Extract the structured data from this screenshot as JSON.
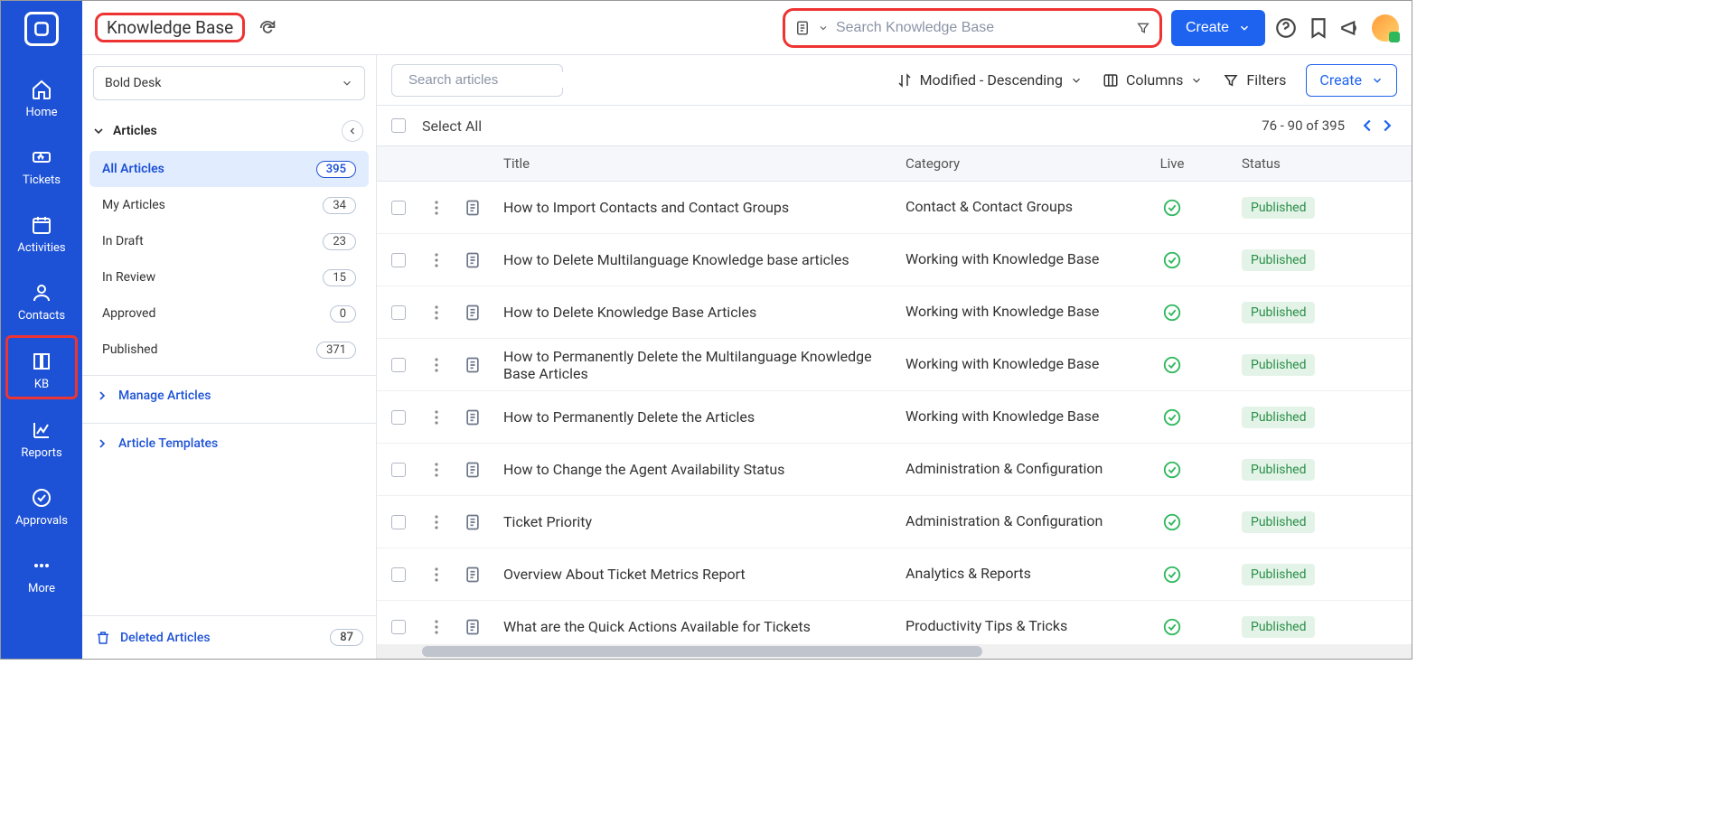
{
  "page": {
    "title": "Knowledge Base"
  },
  "global_search": {
    "placeholder": "Search Knowledge Base"
  },
  "top_create": "Create",
  "sidenav": [
    {
      "id": "home",
      "label": "Home"
    },
    {
      "id": "tickets",
      "label": "Tickets"
    },
    {
      "id": "activities",
      "label": "Activities"
    },
    {
      "id": "contacts",
      "label": "Contacts"
    },
    {
      "id": "kb",
      "label": "KB"
    },
    {
      "id": "reports",
      "label": "Reports"
    },
    {
      "id": "approvals",
      "label": "Approvals"
    },
    {
      "id": "more",
      "label": "More"
    }
  ],
  "brand_selected": "Bold Desk",
  "articles_section": "Articles",
  "views": [
    {
      "label": "All Articles",
      "count": "395"
    },
    {
      "label": "My Articles",
      "count": "34"
    },
    {
      "label": "In Draft",
      "count": "23"
    },
    {
      "label": "In Review",
      "count": "15"
    },
    {
      "label": "Approved",
      "count": "0"
    },
    {
      "label": "Published",
      "count": "371"
    }
  ],
  "manage_articles": "Manage Articles",
  "article_templates": "Article Templates",
  "deleted_articles": {
    "label": "Deleted Articles",
    "count": "87"
  },
  "search_articles_placeholder": "Search articles",
  "sort_label": "Modified - Descending",
  "columns_label": "Columns",
  "filters_label": "Filters",
  "create_label": "Create",
  "select_all": "Select All",
  "range": "76 - 90 of 395",
  "cols": {
    "title": "Title",
    "category": "Category",
    "live": "Live",
    "status": "Status"
  },
  "rows": [
    {
      "title": "How to Import Contacts and Contact Groups",
      "category": "Contact & Contact Groups",
      "status": "Published"
    },
    {
      "title": "How to Delete  Multilanguage Knowledge base articles",
      "category": "Working with Knowledge Base",
      "status": "Published"
    },
    {
      "title": "How to Delete Knowledge Base Articles",
      "category": "Working with Knowledge Base",
      "status": "Published"
    },
    {
      "title": "How to Permanently Delete the Multilanguage Knowledge Base Articles",
      "category": "Working with Knowledge Base",
      "status": "Published"
    },
    {
      "title": "How to Permanently Delete the Articles",
      "category": "Working with Knowledge Base",
      "status": "Published"
    },
    {
      "title": "How to Change the Agent Availability Status",
      "category": "Administration & Configuration",
      "status": "Published"
    },
    {
      "title": "Ticket Priority",
      "category": "Administration & Configuration",
      "status": "Published"
    },
    {
      "title": "Overview About Ticket Metrics Report",
      "category": "Analytics & Reports",
      "status": "Published"
    },
    {
      "title": "What are the Quick Actions Available for Tickets",
      "category": "Productivity Tips & Tricks",
      "status": "Published"
    }
  ]
}
